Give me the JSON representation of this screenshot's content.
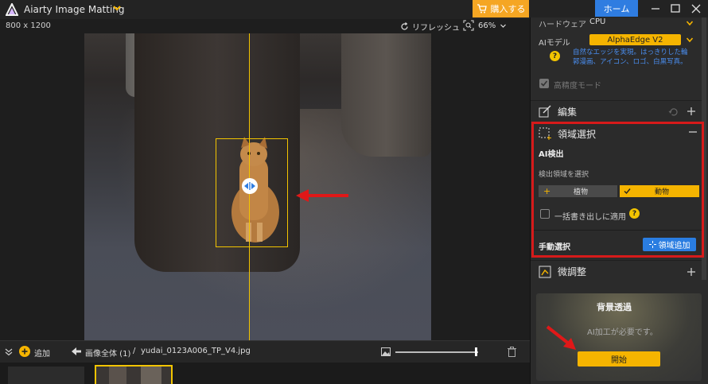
{
  "app": {
    "title": "Aiarty Image Matting"
  },
  "titlebar": {
    "buy_label": "購入する",
    "home_label": "ホーム"
  },
  "canvas": {
    "dimensions": "800 x 1200",
    "refresh_label": "リフレッシュ",
    "zoom": "66%"
  },
  "bottombar": {
    "add_label": "追加",
    "breadcrumb_all": "画像全体 (1)",
    "separator": "/",
    "filename": "yudai_0123A006_TP_V4.jpg"
  },
  "panel": {
    "hardware_label": "ハードウェア",
    "hardware_value": "CPU",
    "ai_model_label": "AIモデル",
    "ai_model_value": "AlphaEdge  V2",
    "ai_model_desc": "自然なエッジを実現。はっきりした輪郭漫画、アイコン、ロゴ、白黒写真。",
    "hq_mode_label": "高精度モード",
    "edit_label": "編集",
    "region_label": "領域選択",
    "ai_detect_label": "AI検出",
    "detect_region_label": "検出領域を選択",
    "plant_label": "植物",
    "animal_label": "動物",
    "batch_label": "一括書き出しに適用",
    "manual_label": "手動選択",
    "add_region_label": "領域追加",
    "fine_tune_label": "微調整",
    "bg_card_title": "背景透過",
    "bg_card_desc": "AI加工が必要です。",
    "start_label": "開始"
  },
  "colors": {
    "accent": "#f5b400",
    "brand": "#2f7de1",
    "highlight": "#d61a1a"
  }
}
